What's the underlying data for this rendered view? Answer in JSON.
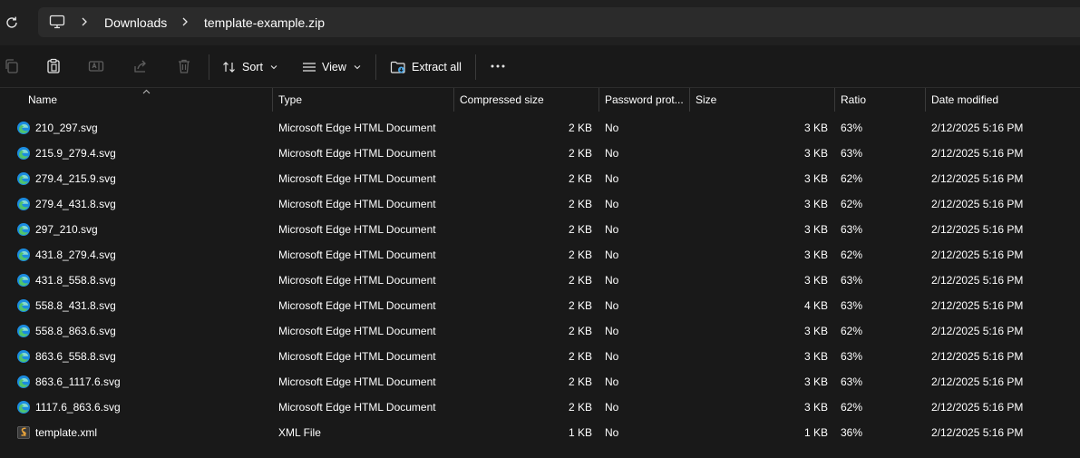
{
  "breadcrumb": [
    "Downloads",
    "template-example.zip"
  ],
  "toolbar": {
    "sort_label": "Sort",
    "view_label": "View",
    "extract_label": "Extract all"
  },
  "columns": {
    "name": "Name",
    "type": "Type",
    "compressed": "Compressed size",
    "password": "Password prot...",
    "size": "Size",
    "ratio": "Ratio",
    "date": "Date modified"
  },
  "files": [
    {
      "name": "210_297.svg",
      "icon": "edge-icon",
      "type": "Microsoft Edge HTML Document",
      "compressed": "2 KB",
      "password": "No",
      "size": "3 KB",
      "ratio": "63%",
      "date": "2/12/2025 5:16 PM"
    },
    {
      "name": "215.9_279.4.svg",
      "icon": "edge-icon",
      "type": "Microsoft Edge HTML Document",
      "compressed": "2 KB",
      "password": "No",
      "size": "3 KB",
      "ratio": "63%",
      "date": "2/12/2025 5:16 PM"
    },
    {
      "name": "279.4_215.9.svg",
      "icon": "edge-icon",
      "type": "Microsoft Edge HTML Document",
      "compressed": "2 KB",
      "password": "No",
      "size": "3 KB",
      "ratio": "62%",
      "date": "2/12/2025 5:16 PM"
    },
    {
      "name": "279.4_431.8.svg",
      "icon": "edge-icon",
      "type": "Microsoft Edge HTML Document",
      "compressed": "2 KB",
      "password": "No",
      "size": "3 KB",
      "ratio": "62%",
      "date": "2/12/2025 5:16 PM"
    },
    {
      "name": "297_210.svg",
      "icon": "edge-icon",
      "type": "Microsoft Edge HTML Document",
      "compressed": "2 KB",
      "password": "No",
      "size": "3 KB",
      "ratio": "63%",
      "date": "2/12/2025 5:16 PM"
    },
    {
      "name": "431.8_279.4.svg",
      "icon": "edge-icon",
      "type": "Microsoft Edge HTML Document",
      "compressed": "2 KB",
      "password": "No",
      "size": "3 KB",
      "ratio": "62%",
      "date": "2/12/2025 5:16 PM"
    },
    {
      "name": "431.8_558.8.svg",
      "icon": "edge-icon",
      "type": "Microsoft Edge HTML Document",
      "compressed": "2 KB",
      "password": "No",
      "size": "3 KB",
      "ratio": "63%",
      "date": "2/12/2025 5:16 PM"
    },
    {
      "name": "558.8_431.8.svg",
      "icon": "edge-icon",
      "type": "Microsoft Edge HTML Document",
      "compressed": "2 KB",
      "password": "No",
      "size": "4 KB",
      "ratio": "63%",
      "date": "2/12/2025 5:16 PM"
    },
    {
      "name": "558.8_863.6.svg",
      "icon": "edge-icon",
      "type": "Microsoft Edge HTML Document",
      "compressed": "2 KB",
      "password": "No",
      "size": "3 KB",
      "ratio": "62%",
      "date": "2/12/2025 5:16 PM"
    },
    {
      "name": "863.6_558.8.svg",
      "icon": "edge-icon",
      "type": "Microsoft Edge HTML Document",
      "compressed": "2 KB",
      "password": "No",
      "size": "3 KB",
      "ratio": "63%",
      "date": "2/12/2025 5:16 PM"
    },
    {
      "name": "863.6_1117.6.svg",
      "icon": "edge-icon",
      "type": "Microsoft Edge HTML Document",
      "compressed": "2 KB",
      "password": "No",
      "size": "3 KB",
      "ratio": "63%",
      "date": "2/12/2025 5:16 PM"
    },
    {
      "name": "1117.6_863.6.svg",
      "icon": "edge-icon",
      "type": "Microsoft Edge HTML Document",
      "compressed": "2 KB",
      "password": "No",
      "size": "3 KB",
      "ratio": "62%",
      "date": "2/12/2025 5:16 PM"
    },
    {
      "name": "template.xml",
      "icon": "xml-file-icon",
      "type": "XML File",
      "compressed": "1 KB",
      "password": "No",
      "size": "1 KB",
      "ratio": "36%",
      "date": "2/12/2025 5:16 PM"
    }
  ],
  "colors": {
    "background": "#191919",
    "toolbar": "#202020",
    "addressbar": "#2b2b2b",
    "text": "#ffffff",
    "edge_blue": "#1b8ce0",
    "edge_green": "#4fc36e",
    "xml_orange": "#e8a33a"
  }
}
